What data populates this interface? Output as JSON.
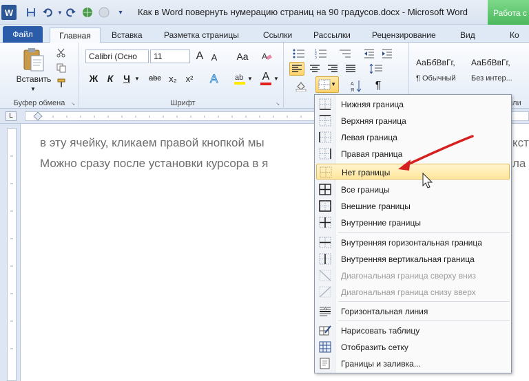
{
  "window": {
    "title": "Как в Word повернуть нумерацию страниц на 90 градусов.docx  -  Microsoft Word",
    "context_tab": "Работа с"
  },
  "quick_access": {
    "logo_letter": "W"
  },
  "tabs": [
    {
      "label": "Файл"
    },
    {
      "label": "Главная"
    },
    {
      "label": "Вставка"
    },
    {
      "label": "Разметка страницы"
    },
    {
      "label": "Ссылки"
    },
    {
      "label": "Рассылки"
    },
    {
      "label": "Рецензирование"
    },
    {
      "label": "Вид"
    },
    {
      "label": "Ко"
    }
  ],
  "ribbon": {
    "clipboard": {
      "paste_label": "Вставить",
      "group_label": "Буфер обмена"
    },
    "font": {
      "font_name": "Calibri (Осно",
      "font_size": "11",
      "group_label": "Шрифт",
      "grow_font": "A",
      "shrink_font": "A",
      "change_case": "Aa",
      "bold": "Ж",
      "italic": "К",
      "underline": "Ч",
      "strike": "abc",
      "subscript": "x₂",
      "superscript": "x²",
      "font_color": "A"
    },
    "styles": [
      {
        "preview": "АаБбВвГг,",
        "name": "¶ Обычный"
      },
      {
        "preview": "АаБбВвГг,",
        "name": "Без интер..."
      }
    ],
    "styles_group_label_tail": "или"
  },
  "ruler": {
    "tab_selector": "L"
  },
  "document": {
    "lines": [
      "в эту ячейку, кликаем правой кнопкой мы",
      "Можно сразу после установки курсора в я"
    ],
    "right_fragments": [
      "кст",
      "ла"
    ]
  },
  "borders_menu": {
    "items": [
      {
        "label": "Нижняя граница",
        "icon": "bottom-border-icon"
      },
      {
        "label": "Верхняя граница",
        "icon": "top-border-icon"
      },
      {
        "label": "Левая граница",
        "icon": "left-border-icon"
      },
      {
        "label": "Правая граница",
        "icon": "right-border-icon"
      },
      {
        "label": "Нет границы",
        "icon": "no-border-icon",
        "state": "hover"
      },
      {
        "label": "Все границы",
        "icon": "all-borders-icon"
      },
      {
        "label": "Внешние границы",
        "icon": "outside-borders-icon"
      },
      {
        "label": "Внутренние границы",
        "icon": "inside-borders-icon"
      },
      {
        "label": "Внутренняя горизонтальная граница",
        "icon": "inside-horizontal-border-icon"
      },
      {
        "label": "Внутренняя вертикальная граница",
        "icon": "inside-vertical-border-icon"
      },
      {
        "label": "Диагональная граница сверху вниз",
        "icon": "diagonal-down-border-icon",
        "state": "disabled"
      },
      {
        "label": "Диагональная граница снизу вверх",
        "icon": "diagonal-up-border-icon",
        "state": "disabled"
      },
      {
        "label": "Горизонтальная линия",
        "icon": "horizontal-line-icon"
      },
      {
        "label": "Нарисовать таблицу",
        "icon": "draw-table-icon"
      },
      {
        "label": "Отобразить сетку",
        "icon": "view-gridlines-icon"
      },
      {
        "label": "Границы и заливка...",
        "icon": "borders-and-shading-icon"
      }
    ]
  },
  "colors": {
    "file_tab": "#2a5caa",
    "hover_highlight": "#ffe69a",
    "annotation_arrow": "#d62020",
    "context_tab": "#4cb85e"
  }
}
